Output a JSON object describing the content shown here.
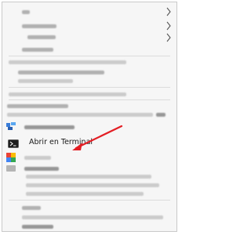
{
  "context_menu": {
    "highlighted_item": {
      "label": "Abrir en Terminal",
      "icon": "terminal-icon"
    },
    "submenu_chevron_icon": "chevron-right-icon",
    "annotation_arrow_color": "#e31e24"
  }
}
